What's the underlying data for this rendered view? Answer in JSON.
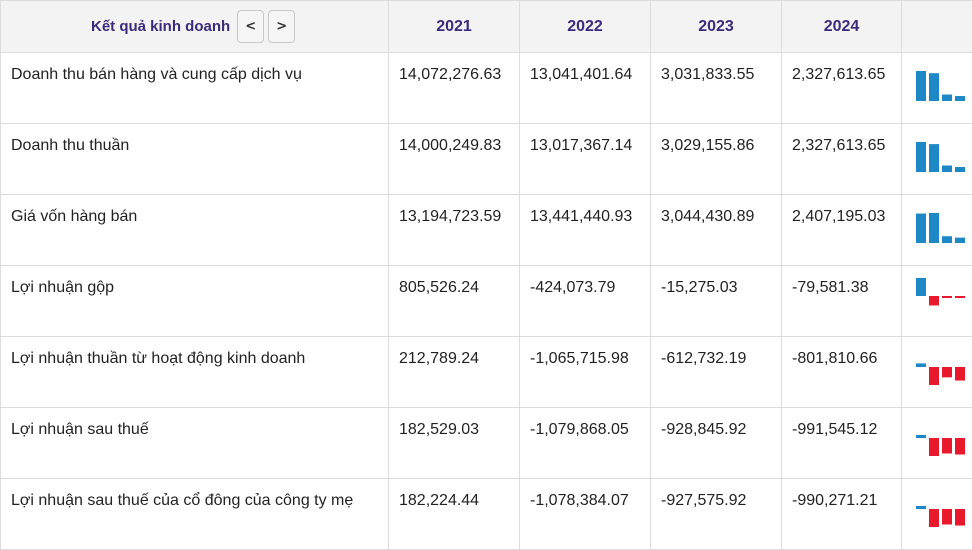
{
  "header": {
    "title": "Kết quả kinh doanh",
    "prev_label": "<",
    "next_label": ">",
    "years": [
      "2021",
      "2022",
      "2023",
      "2024"
    ]
  },
  "colors": {
    "positive": "#1e88c7",
    "negative": "#e8192c"
  },
  "rows": [
    {
      "label": "Doanh thu bán hàng và cung cấp dịch vụ",
      "values": [
        "14,072,276.63",
        "13,041,401.64",
        "3,031,833.55",
        "2,327,613.65"
      ],
      "spark": [
        14072276.63,
        13041401.64,
        3031833.55,
        2327613.65
      ]
    },
    {
      "label": "Doanh thu thuần",
      "values": [
        "14,000,249.83",
        "13,017,367.14",
        "3,029,155.86",
        "2,327,613.65"
      ],
      "spark": [
        14000249.83,
        13017367.14,
        3029155.86,
        2327613.65
      ]
    },
    {
      "label": "Giá vốn hàng bán",
      "values": [
        "13,194,723.59",
        "13,441,440.93",
        "3,044,430.89",
        "2,407,195.03"
      ],
      "spark": [
        13194723.59,
        13441440.93,
        3044430.89,
        2407195.03
      ]
    },
    {
      "label": "Lợi nhuận gộp",
      "values": [
        "805,526.24",
        "-424,073.79",
        "-15,275.03",
        "-79,581.38"
      ],
      "spark": [
        805526.24,
        -424073.79,
        -15275.03,
        -79581.38
      ]
    },
    {
      "label": "Lợi nhuận thuần từ hoạt động kinh doanh",
      "values": [
        "212,789.24",
        "-1,065,715.98",
        "-612,732.19",
        "-801,810.66"
      ],
      "spark": [
        212789.24,
        -1065715.98,
        -612732.19,
        -801810.66
      ]
    },
    {
      "label": "Lợi nhuận sau thuế",
      "values": [
        "182,529.03",
        "-1,079,868.05",
        "-928,845.92",
        "-991,545.12"
      ],
      "spark": [
        182529.03,
        -1079868.05,
        -928845.92,
        -991545.12
      ]
    },
    {
      "label": "Lợi nhuận sau thuế của cổ đông của công ty mẹ",
      "values": [
        "182,224.44",
        "-1,078,384.07",
        "-927,575.92",
        "-990,271.21"
      ],
      "spark": [
        182224.44,
        -1078384.07,
        -927575.92,
        -990271.21
      ]
    }
  ]
}
